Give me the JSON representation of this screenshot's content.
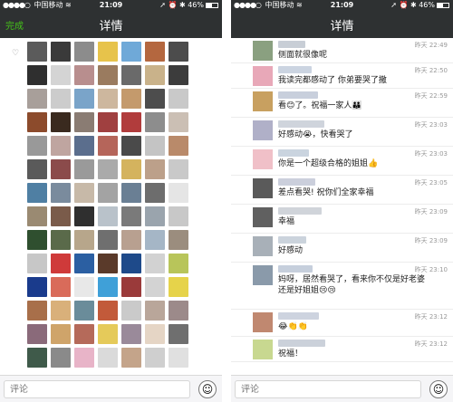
{
  "screens": [
    {
      "status": {
        "carrier": "中国移动",
        "time": "21:09",
        "battery": "46%",
        "dots": "●●●●○",
        "wifi": "≋",
        "icons": "➚ ⏰ ✱"
      },
      "nav": {
        "back_label": "完成",
        "title": "详情"
      },
      "likes_heart": "♡",
      "avatars": [
        "#5b5b5b",
        "#3a3a3a",
        "#8c8c8c",
        "#e7c34b",
        "#6fa9d8",
        "#b4673f",
        "#4c4c4c",
        "#2f2f2f",
        "#d4d4d4",
        "#b88e8e",
        "#9a7b5f",
        "#6a6a6a",
        "#c9b28a",
        "#3c3c3c",
        "#a89f9a",
        "#cccccc",
        "#7aa4c9",
        "#cdb79e",
        "#c49a6c",
        "#4d4d4d",
        "#c9c9c9",
        "#8c4b2c",
        "#3a2a1f",
        "#8a7c73",
        "#a04040",
        "#b13c3c",
        "#8d8d8d",
        "#cbbfb4",
        "#999999",
        "#bfa5a0",
        "#5b6e8d",
        "#b5655a",
        "#4a4a4a",
        "#c4c4c4",
        "#b98a6a",
        "#5a5a5a",
        "#8b4b4b",
        "#9a9a9a",
        "#aaaaaa",
        "#d4b35e",
        "#bca08a",
        "#c9c9c9",
        "#4f7fa3",
        "#7a8b9d",
        "#c7b9a8",
        "#a3a3a3",
        "#6a7f94",
        "#6d6d6d",
        "#e5e5e5",
        "#9a8a72",
        "#7a5b4a",
        "#2f2f2f",
        "#b9c2ca",
        "#7a7a7a",
        "#9aa4ad",
        "#c8c8c8",
        "#2f4f2f",
        "#5a6a4a",
        "#b7a68b",
        "#6f6f6f",
        "#b8a090",
        "#a5b6c6",
        "#9b8d7e",
        "#c7c7c7",
        "#cf3a3a",
        "#2b5fa2",
        "#5a3a2a",
        "#1e4a8a",
        "#d2d2d2",
        "#b8c55a",
        "#1a3b8c",
        "#d96b5a",
        "#e8e8e8",
        "#3fa0d8",
        "#9a3a3a",
        "#d3d3d3",
        "#e6d34a",
        "#a86f4a",
        "#d9b07a",
        "#6a8c9a",
        "#c25a3a",
        "#cacaca",
        "#b9a69a",
        "#9c8a8a",
        "#8a6a7a",
        "#cfa46a",
        "#b56a5a",
        "#e5ca5a",
        "#9a8a9a",
        "#e5d5c5",
        "#6f6f6f",
        "#3f5a4a",
        "#8a8a8a",
        "#e8b4c8",
        "#dadada",
        "#c4a48a",
        "#cfcfcf",
        "#e0e0e0"
      ]
    },
    {
      "status": {
        "carrier": "中国移动",
        "time": "21:09",
        "battery": "46%",
        "dots": "●●●●○",
        "wifi": "≋",
        "icons": "➚ ⏰ ✱"
      },
      "nav": {
        "back_label": "",
        "title": "详情"
      },
      "comments": [
        {
          "time": "昨天 22:49",
          "text": "侧面就很像呢",
          "avatar_color": "#8aa080",
          "name_color": "#9aa5b5"
        },
        {
          "time": "昨天 22:50",
          "text": "我读完都感动了 你弟要哭了撒",
          "avatar_color": "#e8a8b8",
          "name_color": "#a0b0c8"
        },
        {
          "time": "昨天 22:59",
          "text": "看😊了。祝福一家人👪",
          "avatar_color": "#c8a060",
          "name_color": "#9aa8c0"
        },
        {
          "time": "昨天 23:03",
          "text": "好感动😭，快看哭了",
          "avatar_color": "#b0b0c8",
          "name_color": "#a8b0c0"
        },
        {
          "time": "昨天 23:03",
          "text": "你是一个超级合格的姐姐👍",
          "avatar_color": "#f0c0c8",
          "name_color": "#9fb0c4"
        },
        {
          "time": "昨天 23:05",
          "text": "差点看哭! 祝你们全家幸福",
          "avatar_color": "#5a5a5a",
          "name_color": "#a0a8c0"
        },
        {
          "time": "昨天 23:09",
          "text": "幸福",
          "avatar_color": "#606060",
          "name_color": "#aab0bc"
        },
        {
          "time": "昨天 23:09",
          "text": "好感动",
          "avatar_color": "#a8b0b8",
          "name_color": "#a0aec0"
        },
        {
          "time": "昨天 23:10",
          "text": "妈呀，居然看哭了，看来你不仅是好老婆\n还是好姐姐😢😢",
          "avatar_color": "#8a9aaa",
          "name_color": "#98a8c0"
        },
        {
          "time": "昨天 23:12",
          "text": "😂👏👏",
          "avatar_color": "#c08870",
          "name_color": "#a4aec4"
        },
        {
          "time": "昨天 23:12",
          "text": "祝福！",
          "avatar_color": "#c8d890",
          "name_color": "#a0acbc"
        }
      ]
    }
  ],
  "comment_bar": {
    "placeholder": "评论",
    "emoji_icon": "☺"
  }
}
